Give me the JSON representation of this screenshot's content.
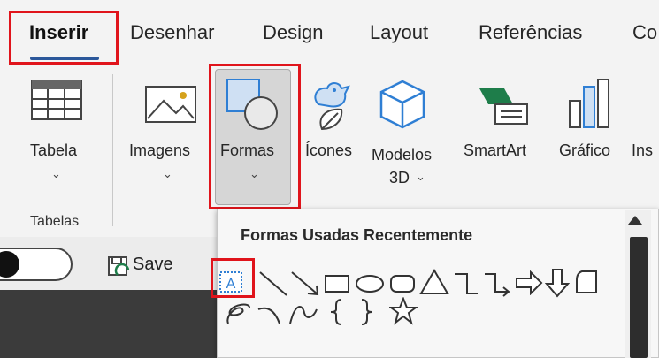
{
  "tabs": [
    {
      "label": "Inserir",
      "active": true
    },
    {
      "label": "Desenhar"
    },
    {
      "label": "Design"
    },
    {
      "label": "Layout"
    },
    {
      "label": "Referências"
    },
    {
      "label": "Co"
    }
  ],
  "ribbon": {
    "tabela": "Tabela",
    "imagens": "Imagens",
    "formas": "Formas",
    "icones": "Ícones",
    "modelos_line1": "Modelos",
    "modelos_line2": "3D",
    "smartart": "SmartArt",
    "grafico": "Gráfico",
    "ins": "Ins",
    "group_tabelas": "Tabelas"
  },
  "toolbar2": {
    "save": "Save"
  },
  "dropdown": {
    "title": "Formas Usadas Recentemente",
    "textbox_glyph": "A"
  },
  "colors": {
    "accent": "#2b579a",
    "highlight_red": "#e0141b",
    "smartart_green": "#1e7d4a",
    "icon_blue": "#2f7fd4"
  }
}
